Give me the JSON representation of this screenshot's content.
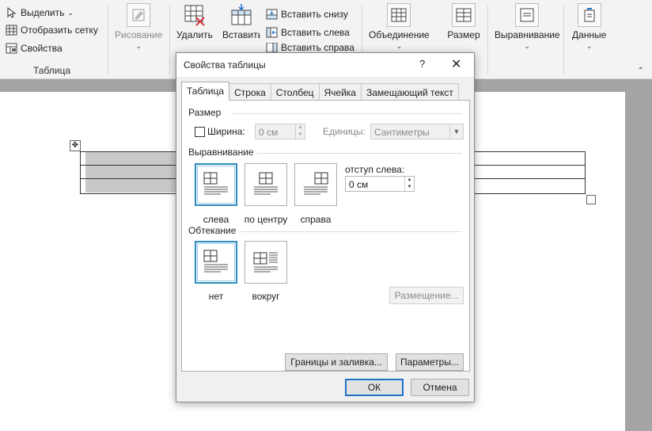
{
  "ribbon": {
    "select_label": "Выделить",
    "gridlines_label": "Отобразить сетку",
    "properties_label": "Свойства",
    "group_table_label": "Таблица",
    "draw_label": "Рисование",
    "delete_label": "Удалить",
    "insert_above_label": "Вставить сверху",
    "insert_below_label": "Вставить снизу",
    "insert_left_label": "Вставить слева",
    "insert_right_label": "Вставить справа",
    "merge_label": "Объединение",
    "cell_size_label": "Размер ячейки",
    "alignment_label": "Выравнивание",
    "data_label": "Данные"
  },
  "dialog": {
    "title": "Свойства таблицы",
    "help": "?",
    "close": "✕",
    "tabs": [
      "Таблица",
      "Строка",
      "Столбец",
      "Ячейка",
      "Замещающий текст"
    ],
    "size_section": "Размер",
    "width_label": "Ширина:",
    "width_value": "0 см",
    "units_label": "Единицы:",
    "units_value": "Сантиметры",
    "alignment_section": "Выравнивание",
    "align_left": "слева",
    "align_center": "по центру",
    "align_right": "справа",
    "indent_label": "отступ слева:",
    "indent_value": "0 см",
    "wrap_section": "Обтекание",
    "wrap_none": "нет",
    "wrap_around": "вокруг",
    "positioning_button": "Размещение...",
    "borders_button": "Границы и заливка...",
    "options_button": "Параметры...",
    "ok_button": "ОК",
    "cancel_button": "Отмена"
  },
  "colors": {
    "selected_border": "#2e8bbd",
    "default_button_border": "#1e73c9"
  }
}
